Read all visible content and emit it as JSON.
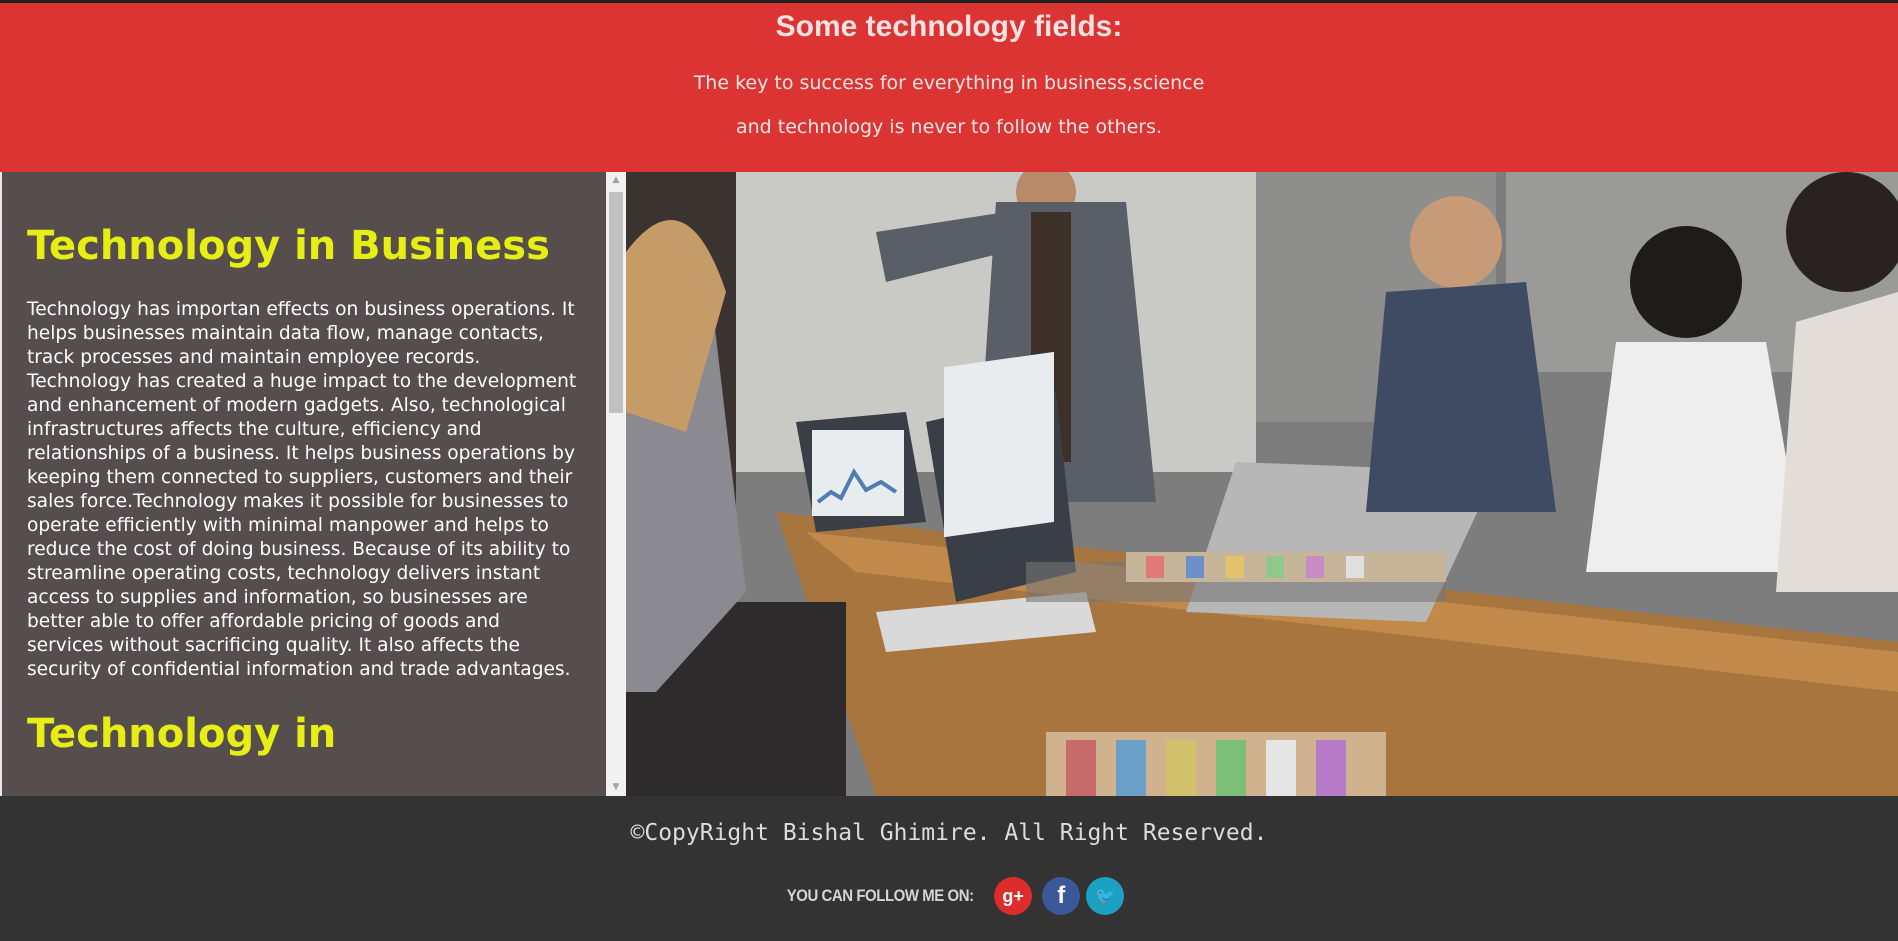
{
  "banner": {
    "title": "Some technology fields:",
    "line1": "The key to success for everything in business,science",
    "line2": "and technology is never to follow the others."
  },
  "panel": {
    "heading1": "Technology in Business",
    "paragraph1": "Technology has importan effects on business operations. It helps businesses maintain data flow, manage contacts, track processes and maintain employee records. Technology has created a huge impact to the development and enhancement of modern gadgets. Also, technological infrastructures affects the culture, efficiency and relationships of a business. It helps business operations by keeping them connected to suppliers, customers and their sales force.Technology makes it possible for businesses to operate efficiently with minimal manpower and helps to reduce the cost of doing business. Because of its ability to streamline operating costs, technology delivers instant access to supplies and information, so businesses are better able to offer affordable pricing of goods and services without sacrificing quality. It also affects the security of confidential information and trade advantages.",
    "heading2": "Technology in"
  },
  "scrollbar": {
    "up_glyph": "▲",
    "down_glyph": "▼"
  },
  "footer": {
    "copyright": "©CopyRight Bishal Ghimire. All Right Reserved.",
    "follow_label": "YOU CAN FOLLOW ME ON:",
    "social": [
      {
        "name": "google-plus",
        "glyph": "g+",
        "color": "#dd2c2c"
      },
      {
        "name": "facebook",
        "glyph": "f",
        "color": "#3b5998"
      },
      {
        "name": "twitter",
        "glyph": "🐦",
        "color": "#1da1c2"
      }
    ]
  },
  "colors": {
    "banner_bg": "#dc3333",
    "panel_bg": "#564d4d",
    "heading": "#e6ee13",
    "footer_bg": "#333333"
  }
}
